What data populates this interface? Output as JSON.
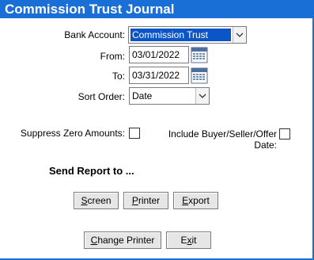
{
  "window": {
    "title": "Commission Trust Journal"
  },
  "form": {
    "bank_account_label": "Bank Account:",
    "bank_account_value": "Commission Trust",
    "from_label": "From:",
    "from_value": "03/01/2022",
    "to_label": "To:",
    "to_value": "03/31/2022",
    "sort_order_label": "Sort Order:",
    "sort_order_value": "Date",
    "suppress_zero_label": "Suppress Zero Amounts:",
    "include_dates_label": "Include Buyer/Seller/Offer Date:"
  },
  "report": {
    "heading": "Send Report to ...",
    "screen_first": "S",
    "screen_rest": "creen",
    "printer_first": "P",
    "printer_rest": "rinter",
    "export_first": "E",
    "export_rest": "xport"
  },
  "footer": {
    "change_printer_pre": "C",
    "change_printer_rest": "hange Printer",
    "exit_pre": "E",
    "exit_first": "x",
    "exit_rest": "it"
  },
  "icons": {
    "calendar": "calendar-icon",
    "dropdown": "chevron-down-icon"
  },
  "colors": {
    "titlebar": "#1a6fd6",
    "selection": "#0a55c8"
  }
}
